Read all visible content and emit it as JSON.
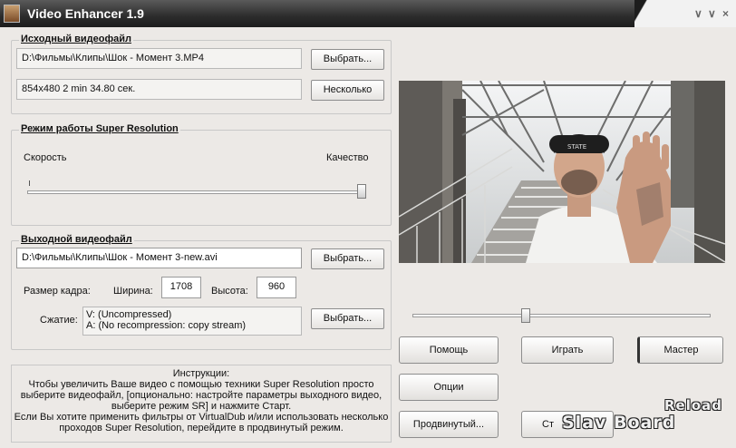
{
  "window": {
    "title": "Video Enhancer 1.9",
    "controls": [
      "∨",
      "∨",
      "×"
    ]
  },
  "source": {
    "group_title": "Исходный видеофайл",
    "path": "D:\\Фильмы\\Клипы\\Шок - Момент 3.MP4",
    "info": "854x480 2 min 34.80 сек.",
    "browse_label": "Выбрать...",
    "multiple_label": "Несколько"
  },
  "mode": {
    "group_title": "Режим работы Super Resolution",
    "speed_label": "Скорость",
    "quality_label": "Качество",
    "slider_level": 1.0
  },
  "output": {
    "group_title": "Выходной видеофайл",
    "path": "D:\\Фильмы\\Клипы\\Шок - Момент 3-new.avi",
    "browse_label": "Выбрать...",
    "frame_size_label": "Размер кадра:",
    "width_label": "Ширина:",
    "width_value": "1708",
    "height_label": "Высота:",
    "height_value": "960",
    "compression_label": "Сжатие:",
    "video_codec": "V: (Uncompressed)",
    "audio_codec": "A: (No recompression: copy stream)",
    "compression_browse_label": "Выбрать..."
  },
  "instructions": {
    "title": "Инструкции:",
    "lines": [
      "Чтобы увеличить Ваше видео с помощью техники Super Resolution просто",
      "выберите видеофайл, [опционально: настройте параметры выходного видео,",
      "выберите режим SR] и нажмите Старт.",
      "Если Вы хотите применить фильтры от VirtualDub и/или использовать несколько",
      "проходов Super Resolution, перейдите в продвинутый режим."
    ]
  },
  "preview": {
    "cap_text": "STATE",
    "seek_position": 0.38
  },
  "buttons": {
    "help": "Помощь",
    "play": "Играть",
    "wizard": "Мастер",
    "options": "Опции",
    "advanced": "Продвинутый...",
    "start_partial": "Ст"
  },
  "watermark": {
    "line1": "Reload",
    "line2": "Slav Board"
  }
}
